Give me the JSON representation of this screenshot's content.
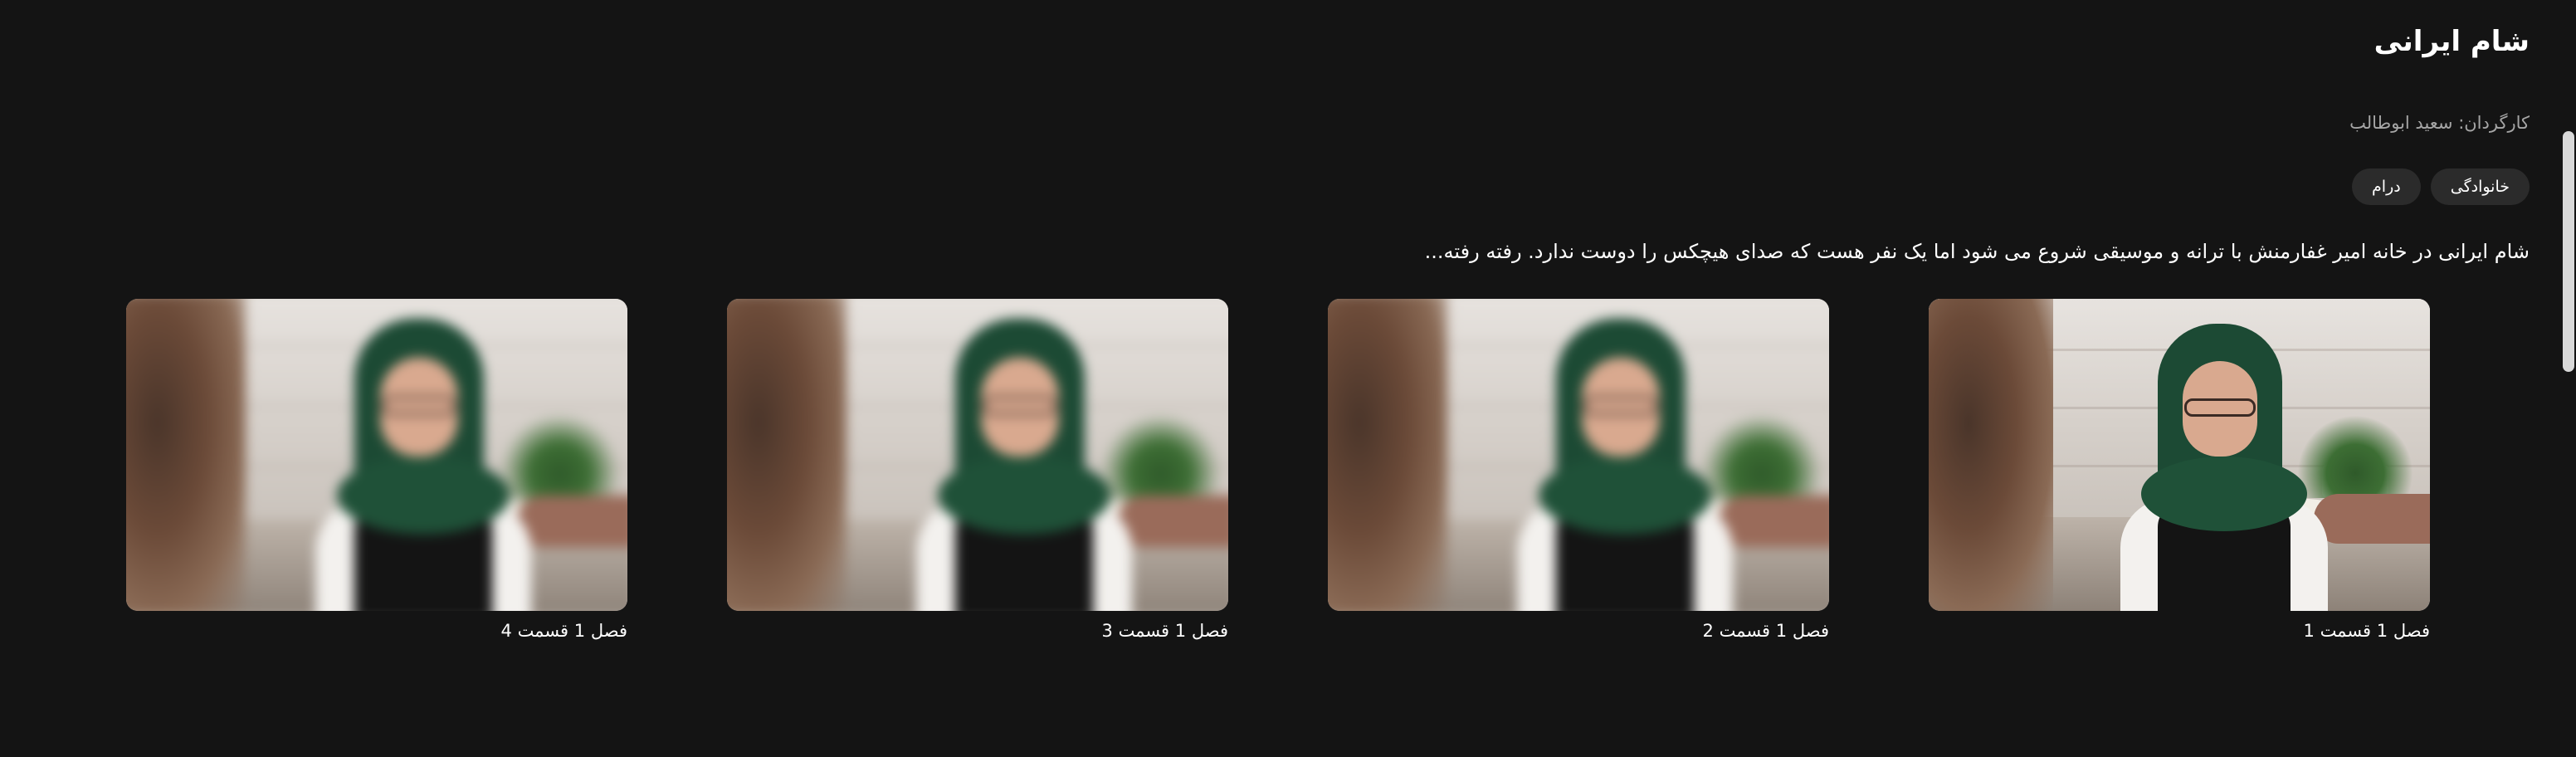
{
  "show": {
    "title": "شام ایرانی",
    "director": "کارگردان: سعید ابوطالب",
    "genres": [
      "خانوادگی",
      "درام"
    ],
    "synopsis": "شام ایرانی در خانه امیر غفارمنش با ترانه و موسیقی شروع می شود اما یک نفر هست که صدای هیچکس را دوست ندارد. رفته رفته..."
  },
  "episodes": [
    {
      "label": "فصل 1 قسمت 1",
      "state": "active"
    },
    {
      "label": "فصل 1 قسمت 2",
      "state": "blurred"
    },
    {
      "label": "فصل 1 قسمت 3",
      "state": "blurred"
    },
    {
      "label": "فصل 1 قسمت 4",
      "state": "blurred"
    }
  ],
  "colors": {
    "background": "#141414",
    "chip": "#2b2b2b",
    "muted_text": "#a6a6a6",
    "scrollbar": "#d9d9d9"
  }
}
